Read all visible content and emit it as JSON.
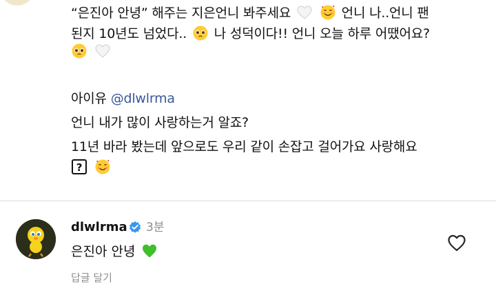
{
  "post": {
    "caption_line1": "“은진아 안녕” 해주는 지은언니 봐주세요",
    "caption_line1_tail": "언니 나..언니 팬",
    "caption_line2": "된지 10년도 넘었다..",
    "caption_line2_tail": "나 성덕이다!! 언니 오늘 하루 어땠어요?",
    "author_name": "아이유",
    "author_handle": "@dlwlrma",
    "body_line1": "언니 내가 많이 사랑하는거 알죠?",
    "body_line2": "11년 바라 봤는데 앞으로도 우리 같이 손잡고 걸어가요 사랑해요",
    "icons": [
      "white-heart-emoji",
      "smiling-face-with-hearts-emoji",
      "pleading-face-emoji",
      "question-mark-box-emoji"
    ]
  },
  "comment": {
    "username": "dlwlrma",
    "verified": true,
    "time": "3분",
    "text": "은진아 안녕",
    "reply_label": "답글 달기",
    "icons": [
      "green-heart-emoji",
      "like-heart-icon",
      "verified-badge-icon",
      "avatar"
    ]
  },
  "colors": {
    "mention": "#385898",
    "muted": "#8e8e8e",
    "verified": "#3897f0",
    "green_heart": "#3fbf2a"
  }
}
